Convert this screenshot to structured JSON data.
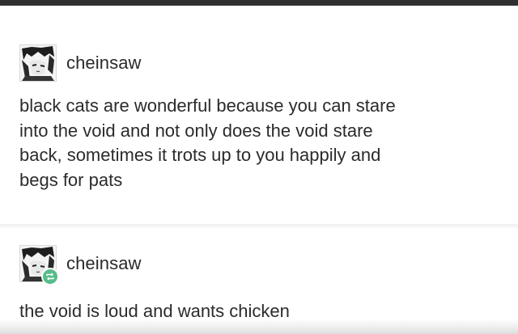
{
  "posts": [
    {
      "username": "cheinsaw",
      "avatar_icon": "anime-avatar-icon",
      "body_lines": [
        "black cats are wonderful because you can stare",
        "into the void and not only does the void stare",
        "back, sometimes it trots up to you happily and",
        "begs for pats"
      ]
    },
    {
      "username": "cheinsaw",
      "avatar_icon": "anime-avatar-icon",
      "badge_icon": "reblog-icon",
      "body_lines": [
        "the void is loud and wants chicken"
      ]
    }
  ],
  "colors": {
    "top_bar": "#2f2f2f",
    "reblog_badge": "#56bc8a",
    "text": "#2b2b2b"
  }
}
